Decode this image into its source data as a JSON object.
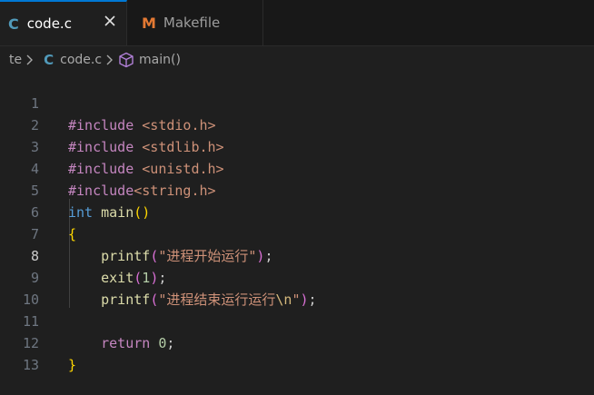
{
  "tabs": [
    {
      "icon": "C",
      "label": "code.c",
      "active": true
    },
    {
      "icon": "M",
      "label": "Makefile",
      "active": false
    }
  ],
  "breadcrumb": {
    "folder": "te",
    "file_icon": "C",
    "file": "code.c",
    "symbol": "main()"
  },
  "line_numbers": [
    "1",
    "2",
    "3",
    "4",
    "5",
    "6",
    "7",
    "8",
    "9",
    "10",
    "11",
    "12",
    "13"
  ],
  "active_line": 8,
  "code": {
    "l1": {
      "directive": "#include",
      "header": " <stdio.h>"
    },
    "l2": {
      "directive": "#include",
      "header": " <stdlib.h>"
    },
    "l3": {
      "directive": "#include",
      "header": " <unistd.h>"
    },
    "l4": {
      "directive": "#include",
      "header": "<string.h>"
    },
    "l5": {
      "type": "int",
      "name": "main",
      "open": "(",
      "close": ")"
    },
    "l6": {
      "brace": "{"
    },
    "l7": {
      "fn": "printf",
      "open": "(",
      "str": "\"进程开始运行\"",
      "close": ")",
      "semi": ";"
    },
    "l8": {
      "fn": "exit",
      "open": "(",
      "num": "1",
      "close": ")",
      "semi": ";"
    },
    "l9": {
      "fn": "printf",
      "open": "(",
      "str": "\"进程结束运行运行",
      "esc": "\\n",
      "str_end": "\"",
      "close": ")",
      "semi": ";"
    },
    "l11": {
      "kw": "return",
      "num": "0",
      "semi": ";"
    },
    "l12": {
      "brace": "}"
    }
  },
  "colors": {
    "accent": "#0078d4",
    "c_icon": "#519aba",
    "makefile_icon": "#e37933"
  }
}
